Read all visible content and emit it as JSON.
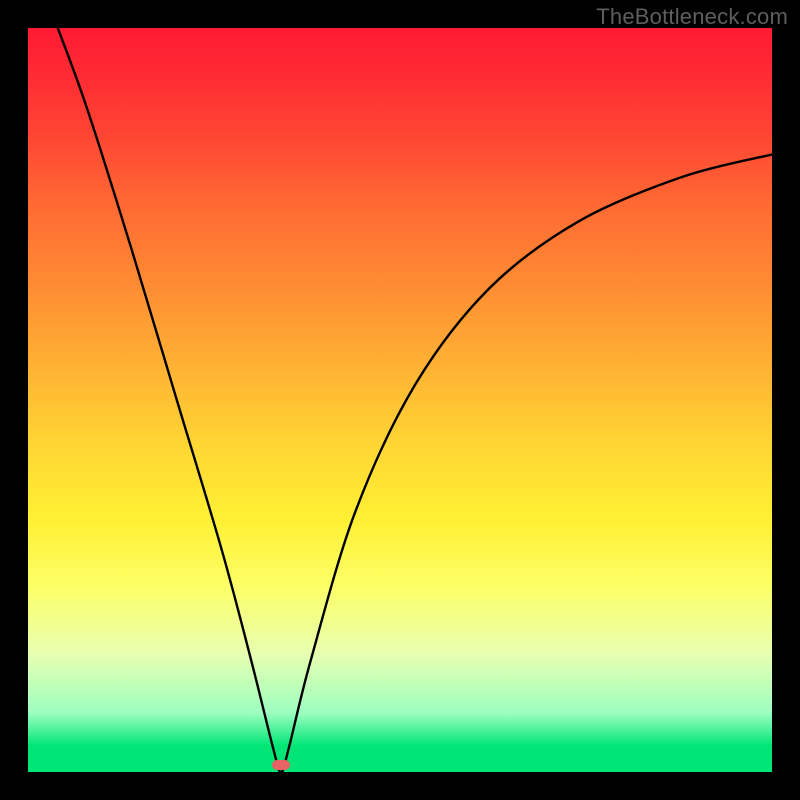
{
  "watermark": {
    "text": "TheBottleneck.com"
  },
  "chart_data": {
    "type": "line",
    "title": "",
    "xlabel": "",
    "ylabel": "",
    "xlim": [
      0,
      100
    ],
    "ylim": [
      0,
      100
    ],
    "grid": false,
    "legend": false,
    "background": "red-yellow-green vertical gradient",
    "curve": {
      "description": "V-shaped bottleneck curve reaching 0 at the optimum then rising asymptotically",
      "points": [
        {
          "x": 4.0,
          "y": 100.0
        },
        {
          "x": 8.0,
          "y": 89.0
        },
        {
          "x": 14.0,
          "y": 70.0
        },
        {
          "x": 20.0,
          "y": 50.0
        },
        {
          "x": 26.0,
          "y": 30.0
        },
        {
          "x": 30.0,
          "y": 15.0
        },
        {
          "x": 33.0,
          "y": 3.0
        },
        {
          "x": 34.0,
          "y": 0.0
        },
        {
          "x": 35.0,
          "y": 3.0
        },
        {
          "x": 38.0,
          "y": 15.0
        },
        {
          "x": 44.0,
          "y": 35.0
        },
        {
          "x": 52.0,
          "y": 52.0
        },
        {
          "x": 62.0,
          "y": 65.0
        },
        {
          "x": 74.0,
          "y": 74.0
        },
        {
          "x": 88.0,
          "y": 80.0
        },
        {
          "x": 100.0,
          "y": 83.0
        }
      ]
    },
    "marker": {
      "x": 34.0,
      "y": 1.0,
      "color": "#e86464"
    },
    "frame": {
      "border_width_px": 28,
      "border_color": "#000000"
    }
  }
}
